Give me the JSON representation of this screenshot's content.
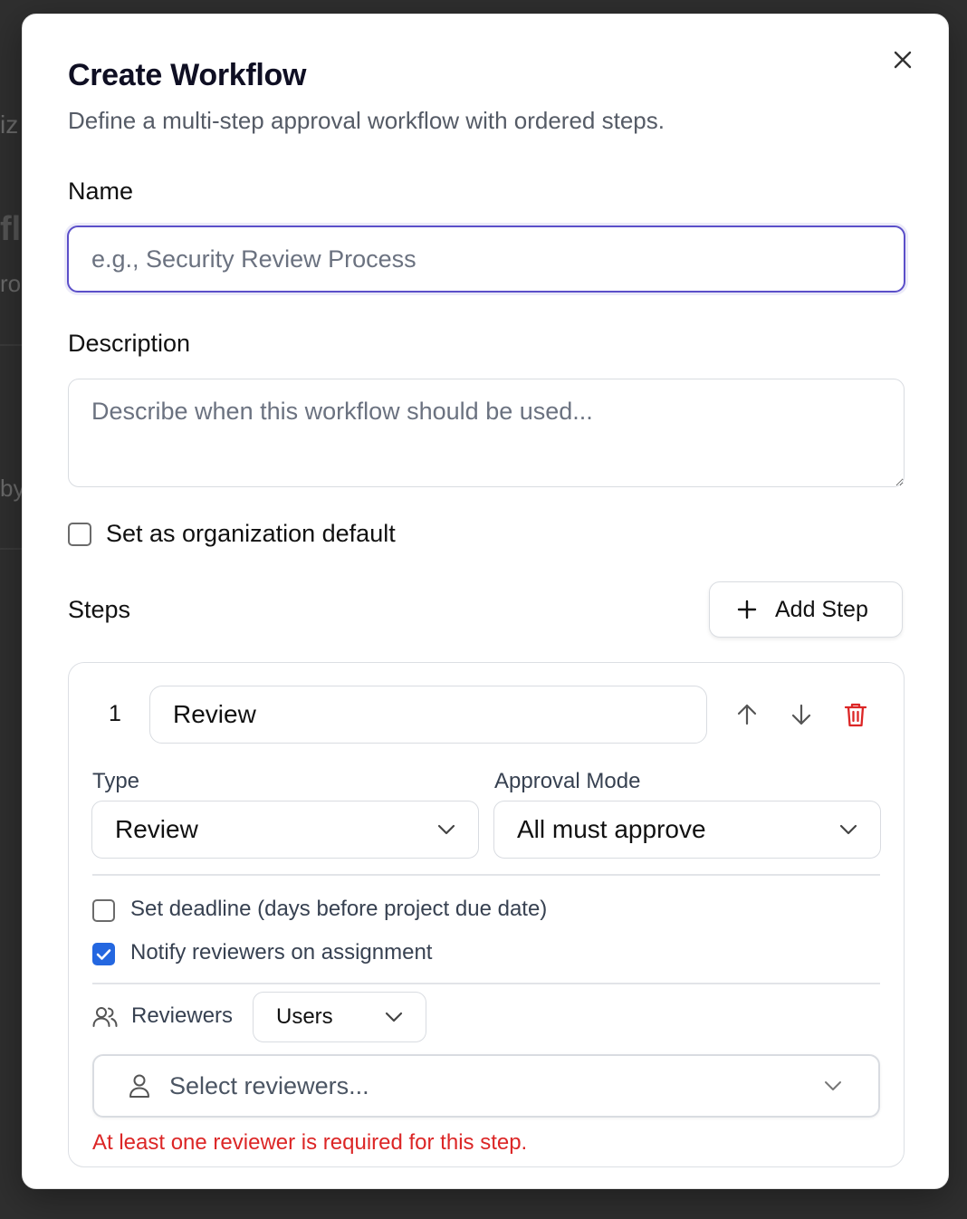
{
  "background": {
    "fragments": [
      "iz",
      "fl",
      "ro",
      "by"
    ]
  },
  "modal": {
    "title": "Create Workflow",
    "subtitle": "Define a multi-step approval workflow with ordered steps.",
    "close_icon": "close-icon"
  },
  "form": {
    "name_label": "Name",
    "name_value": "",
    "name_placeholder": "e.g., Security Review Process",
    "description_label": "Description",
    "description_value": "",
    "description_placeholder": "Describe when this workflow should be used...",
    "org_default_label": "Set as organization default",
    "org_default_checked": false
  },
  "steps": {
    "label": "Steps",
    "add_step_label": "Add Step",
    "items": [
      {
        "number": "1",
        "name": "Review",
        "type_label": "Type",
        "type_value": "Review",
        "approval_mode_label": "Approval Mode",
        "approval_mode_value": "All must approve",
        "deadline_label": "Set deadline (days before project due date)",
        "deadline_checked": false,
        "notify_label": "Notify reviewers on assignment",
        "notify_checked": true,
        "reviewers_label": "Reviewers",
        "reviewers_kind": "Users",
        "reviewers_placeholder": "Select reviewers...",
        "error": "At least one reviewer is required for this step."
      }
    ]
  },
  "colors": {
    "accent": "#5b4fc9",
    "checkbox_checked": "#2467e0",
    "error": "#dc2626",
    "delete_icon": "#dc2626"
  }
}
